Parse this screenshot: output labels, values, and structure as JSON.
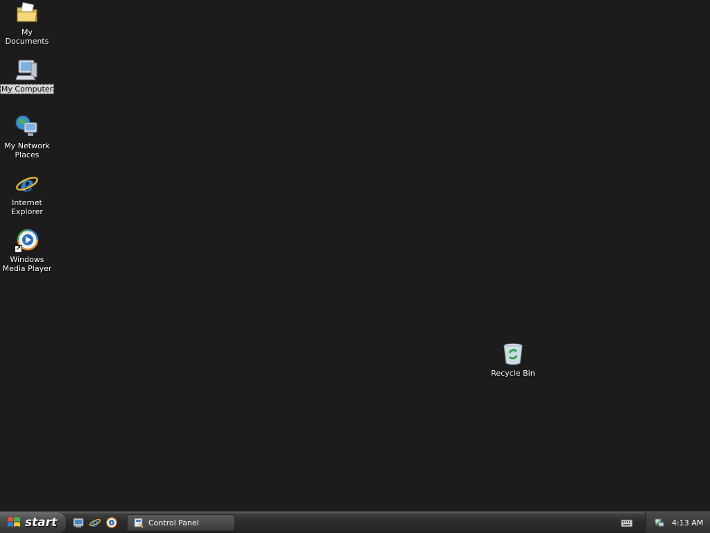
{
  "desktop": {
    "icons": {
      "my_documents": {
        "label": "My Documents",
        "icon": "my-documents-icon"
      },
      "my_computer": {
        "label": "My Computer",
        "icon": "my-computer-icon",
        "selected": true
      },
      "my_network_places": {
        "label": "My Network Places",
        "icon": "my-network-places-icon"
      },
      "internet_explorer": {
        "label": "Internet Explorer",
        "icon": "internet-explorer-icon"
      },
      "windows_media_player": {
        "label": "Windows Media Player",
        "icon": "windows-media-player-icon",
        "shortcut": true
      },
      "recycle_bin": {
        "label": "Recycle Bin",
        "icon": "recycle-bin-icon"
      }
    }
  },
  "taskbar": {
    "start_label": "start",
    "quick_launch": [
      "show-desktop-icon",
      "internet-explorer-icon",
      "windows-media-player-icon"
    ],
    "tasks": [
      {
        "label": "Control Panel",
        "icon": "control-panel-icon"
      }
    ],
    "tray": {
      "clock": "4:13 AM",
      "icons": [
        "keyboard-icon",
        "network-icon"
      ]
    }
  },
  "colors": {
    "desktop_background": "#1c1c1c",
    "taskbar": "#2b2b2b",
    "selection": "#d4d4d4"
  }
}
